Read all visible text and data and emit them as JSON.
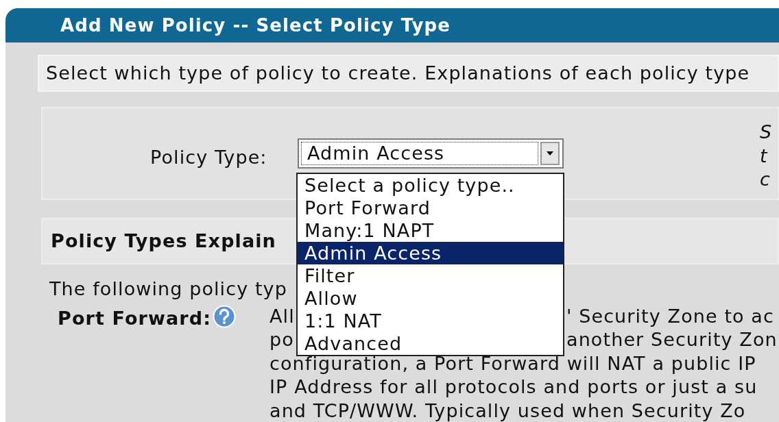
{
  "page_title": "Add New Policy -- Select Policy Type",
  "instructions": "Select which type of policy to create. Explanations of each policy type",
  "policy_type": {
    "label": "Policy Type:",
    "value": "Admin Access",
    "expanded": true,
    "options": [
      {
        "label": "Select a policy type..",
        "selected": false
      },
      {
        "label": "Port Forward",
        "selected": false
      },
      {
        "label": "Many:1 NAPT",
        "selected": false
      },
      {
        "label": "Admin Access",
        "selected": true
      },
      {
        "label": "Filter",
        "selected": false
      },
      {
        "label": "Allow",
        "selected": false
      },
      {
        "label": "1:1 NAT",
        "selected": false
      },
      {
        "label": "Advanced",
        "selected": false
      }
    ]
  },
  "side_note_fragments": [
    "S",
    "t",
    "c"
  ],
  "explanations": {
    "title": "Policy Types Explain",
    "intro": "The following policy typ",
    "items": [
      {
        "name": "Port Forward:",
        "lines": [
          [
            "All",
            "' Security Zone to ac"
          ],
          [
            "po",
            "another Security Zon"
          ],
          [
            "configuration, a Port Forward will NAT a public IP"
          ],
          [
            "IP Address for all protocols and ports or just a su"
          ],
          [
            "and TCP/WWW. Typically used when Security Zo"
          ]
        ]
      }
    ]
  }
}
